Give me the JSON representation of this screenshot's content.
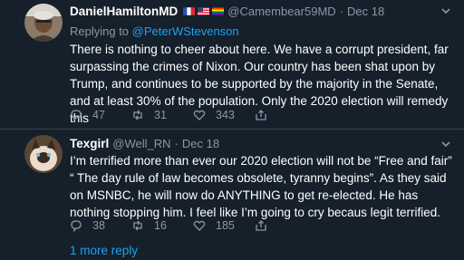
{
  "colors": {
    "background": "#15202b",
    "accent": "#1da1f2",
    "muted": "#8899a6",
    "divider": "#38444d"
  },
  "tweets": [
    {
      "name": "DanielHamiltonMD",
      "handle": "@Camembear59MD",
      "separator": "·",
      "date": "Dec 18",
      "replying_prefix": "Replying to",
      "replying_to": "@PeterWStevenson",
      "text": "There is nothing to cheer about here. We have a corrupt president, far surpassing the crimes of Nixon. Our country has been shat upon by Trump, and continues to be supported by the majority in the Senate, and at least 30% of the population. Only the 2020 election will remedy this",
      "replies": "47",
      "retweets": "31",
      "likes": "343"
    },
    {
      "name": "Texgirl",
      "handle": "@Well_RN",
      "separator": "·",
      "date": "Dec 18",
      "text": "I’m terrified more than ever our 2020 election will not be “Free and fair” “ The day rule of law becomes obsolete, tyranny begins”. As they said on MSNBC, he will now do ANYTHING to get re-elected.  He has nothing stopping him. I feel like I’m going to cry becaus legit terrified.",
      "replies": "38",
      "retweets": "16",
      "likes": "185"
    }
  ],
  "more_replies": "1 more reply"
}
